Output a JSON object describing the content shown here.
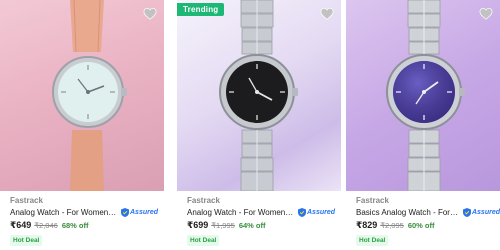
{
  "colors": {
    "price_off": "#388e3c",
    "assured_blue": "#2874f0",
    "trending_bg": "#1db776",
    "hot_deal_bg": "#e7f8ec",
    "hot_deal_text": "#26a541"
  },
  "products": [
    {
      "brand": "Fastrack",
      "title": "Analog Watch - For Women NT6...",
      "assured_label": "Assured",
      "price": "₹649",
      "mrp": "₹2,046",
      "discount": "68% off",
      "deal": "Hot Deal",
      "badge": "",
      "wishlist_icon": "heart-icon",
      "image": {
        "strap": "peach leather",
        "dial": "white"
      }
    },
    {
      "brand": "Fastrack",
      "title": "Analog Watch - For Women NT6...",
      "assured_label": "Assured",
      "price": "₹699",
      "mrp": "₹1,995",
      "discount": "64% off",
      "deal": "Hot Deal",
      "badge": "Trending",
      "wishlist_icon": "heart-icon",
      "image": {
        "strap": "steel bracelet",
        "dial": "black"
      }
    },
    {
      "brand": "Fastrack",
      "title": "Basics Analog Watch - For Wom...",
      "assured_label": "Assured",
      "price": "₹829",
      "mrp": "₹2,095",
      "discount": "60% off",
      "deal": "Hot Deal",
      "badge": "",
      "wishlist_icon": "heart-icon",
      "image": {
        "strap": "steel bracelet",
        "dial": "purple"
      }
    }
  ]
}
